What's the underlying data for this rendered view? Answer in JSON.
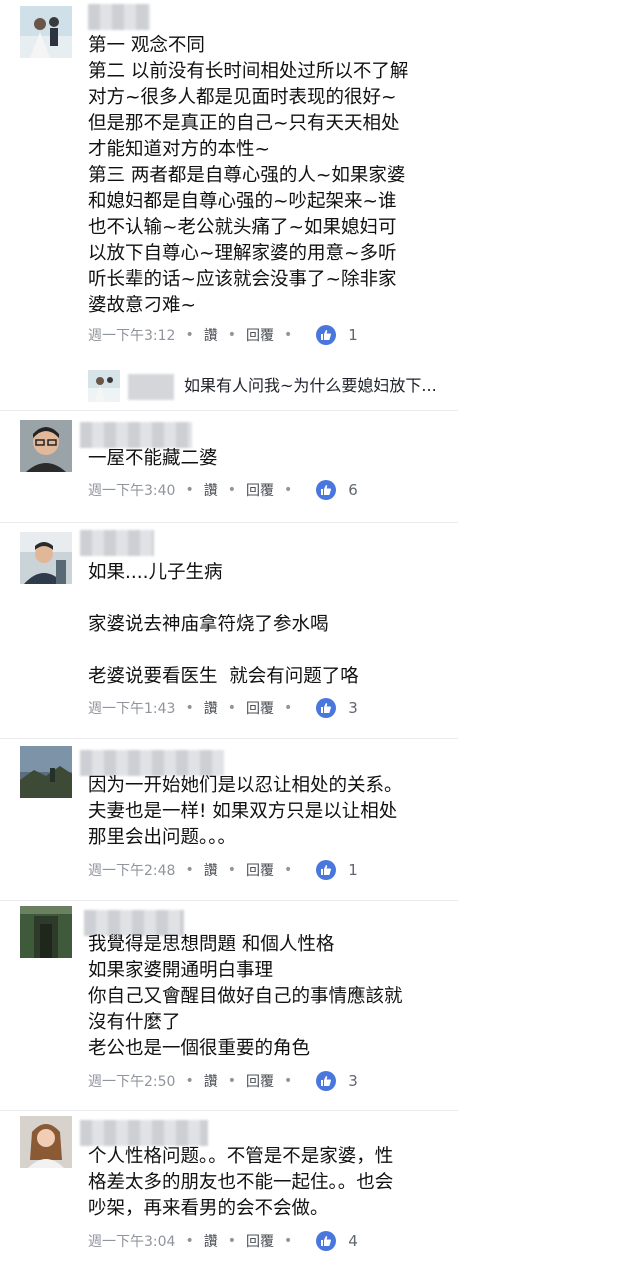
{
  "like_color": "#4a77de",
  "comments": [
    {
      "text": "第一 观念不同\n第二 以前没有长时间相处过所以不了解\n对方~很多人都是见面时表现的很好~\n但是那不是真正的自己~只有天天相处\n才能知道对方的本性~\n第三 两者都是自尊心强的人~如果家婆\n和媳妇都是自尊心强的~吵起架来~谁\n也不认输~老公就头痛了~如果媳妇可\n以放下自尊心~理解家婆的用意~多听\n听长辈的话~应该就会没事了~除非家\n婆故意刁难~",
      "time": "週一下午3:12",
      "like_label": "讚",
      "reply_label": "回覆",
      "likes": "1",
      "reply_preview": "如果有人问我~为什么要媳妇放下..."
    },
    {
      "text": "一屋不能藏二婆",
      "time": "週一下午3:40",
      "like_label": "讚",
      "reply_label": "回覆",
      "likes": "6"
    },
    {
      "text": "如果....儿子生病\n\n家婆说去神庙拿符烧了参水喝\n\n老婆说要看医生  就会有问题了咯",
      "time": "週一下午1:43",
      "like_label": "讚",
      "reply_label": "回覆",
      "likes": "3"
    },
    {
      "text": "因为一开始她们是以忍让相处的关系。\n夫妻也是一样! 如果双方只是以让相处\n那里会出问题。。。",
      "time": "週一下午2:48",
      "like_label": "讚",
      "reply_label": "回覆",
      "likes": "1"
    },
    {
      "text": "我覺得是思想問題 和個人性格\n如果家婆開通明白事理\n你自己又會醒目做好自己的事情應該就\n沒有什麼了\n老公也是一個很重要的角色",
      "time": "週一下午2:50",
      "like_label": "讚",
      "reply_label": "回覆",
      "likes": "3"
    },
    {
      "text": "个人性格问题。。不管是不是家婆，性\n格差太多的朋友也不能一起住。。也会\n吵架，再来看男的会不会做。",
      "time": "週一下午3:04",
      "like_label": "讚",
      "reply_label": "回覆",
      "likes": "4"
    }
  ]
}
